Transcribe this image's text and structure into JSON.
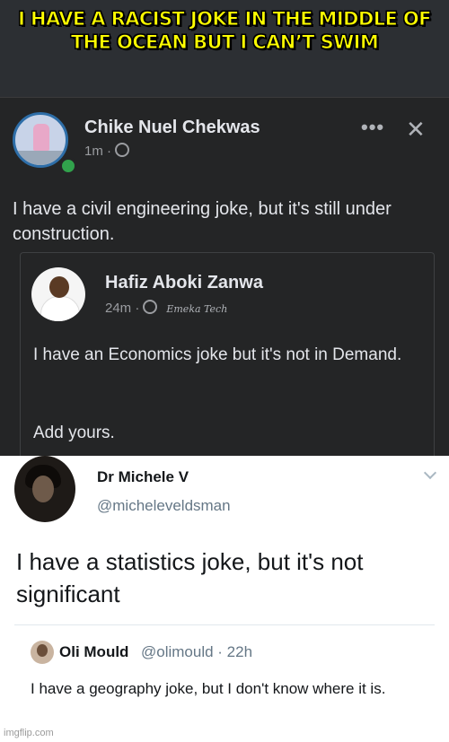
{
  "caption": {
    "text": "I have a racist joke in the middle of the ocean but I can’t swim"
  },
  "facebook_post": {
    "author": "Chike Nuel Chekwas",
    "time": "1m ·",
    "more_label": "•••",
    "close_label": "✕",
    "body": "I have a civil engineering joke, but it's still under construction.",
    "shared_post": {
      "author": "Hafiz Aboki Zanwa",
      "time": "24m ·",
      "watermark": "Emeka Tech",
      "body": "I have an Economics joke but it's not in Demand.",
      "footer": "Add yours."
    }
  },
  "tweet": {
    "author": "Dr Michele V",
    "handle": "@micheleveldsman",
    "body": "I have a statistics joke, but it's not significant",
    "reply": {
      "author": "Oli Mould",
      "handle_time": "@olimould · 22h",
      "body": "I have a geography joke, but I don't know where it is."
    }
  },
  "watermark": "imgflip.com",
  "colors": {
    "caption_text": "#ffff00",
    "fb_background": "#242526",
    "tweet_background": "#ffffff",
    "online_indicator": "#31a24c"
  }
}
